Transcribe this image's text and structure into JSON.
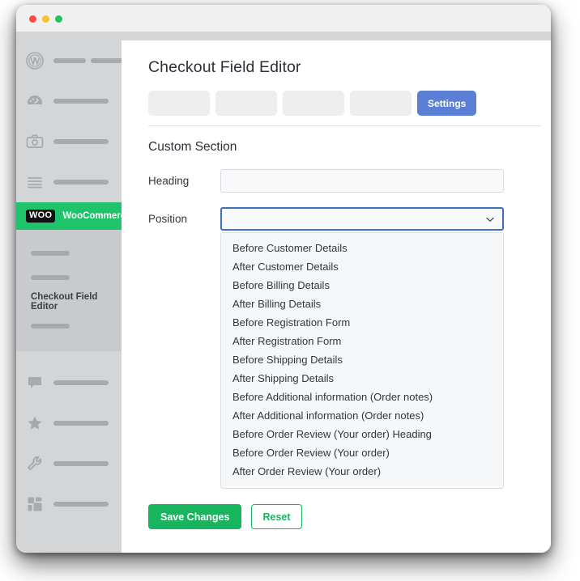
{
  "window": {
    "controls": [
      "close",
      "minimize",
      "maximize"
    ]
  },
  "sidebar": {
    "items": [
      {
        "icon": "wordpress-logo-icon",
        "label": "",
        "bars": [
          40,
          40
        ]
      },
      {
        "icon": "dashboard-gauge-icon",
        "label": "",
        "bars": [
          68
        ]
      },
      {
        "icon": "camera-media-icon",
        "label": "",
        "bars": [
          68
        ]
      },
      {
        "icon": "pages-list-icon",
        "label": "",
        "bars": [
          68
        ]
      }
    ],
    "woocommerce": {
      "logo_text": "WOO",
      "label": "WooCommerce"
    },
    "submenu": {
      "items_before": [
        48,
        48
      ],
      "active_label": "Checkout Field Editor",
      "items_after": [
        48
      ]
    },
    "lower_items": [
      {
        "icon": "comment-bubble-icon",
        "bars": [
          68
        ]
      },
      {
        "icon": "star-icon",
        "bars": [
          68
        ]
      },
      {
        "icon": "wrench-icon",
        "bars": [
          68
        ]
      },
      {
        "icon": "grid-plugins-icon",
        "bars": [
          68
        ]
      }
    ]
  },
  "main": {
    "page_title": "Checkout Field Editor",
    "tabs": [
      {
        "label": "",
        "active": false
      },
      {
        "label": "",
        "active": false
      },
      {
        "label": "",
        "active": false
      },
      {
        "label": "",
        "active": false
      },
      {
        "label": "Settings",
        "active": true
      }
    ],
    "section_title": "Custom Section",
    "form": {
      "heading": {
        "label": "Heading",
        "value": "",
        "placeholder": ""
      },
      "position": {
        "label": "Position",
        "value": "",
        "expanded": true,
        "options": [
          "Before Customer Details",
          "After Customer Details",
          "Before Billing Details",
          "After Billing Details",
          "Before Registration Form",
          "After Registration Form",
          "Before Shipping Details",
          "After Shipping Details",
          "Before Additional information (Order notes)",
          "After Additional information (Order notes)",
          "Before Order Review (Your order) Heading",
          "Before Order Review (Your order)",
          "After Order Review (Your order)"
        ]
      }
    },
    "actions": {
      "save_label": "Save Changes",
      "reset_label": "Reset"
    }
  },
  "colors": {
    "accent_blue": "#5b7fd4",
    "focus_blue": "#3d6fc4",
    "woo_green": "#1fc36b",
    "action_green": "#16b55e",
    "sidebar_gray": "#d4d5d7",
    "submenu_gray": "#c9cacd"
  }
}
